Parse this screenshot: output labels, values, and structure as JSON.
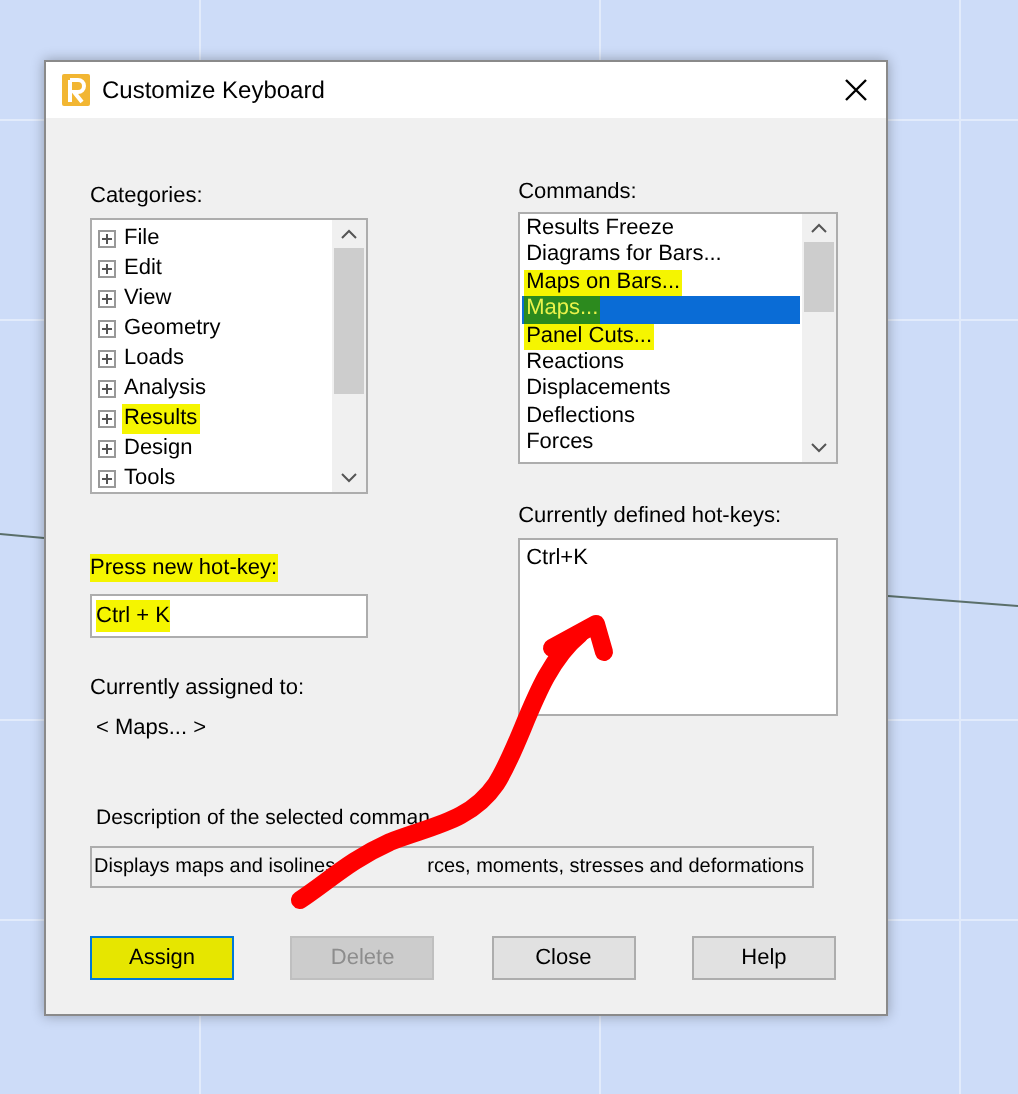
{
  "window": {
    "title": "Customize Keyboard"
  },
  "categories": {
    "label": "Categories:",
    "items": [
      {
        "text": "File",
        "highlighted": false
      },
      {
        "text": "Edit",
        "highlighted": false
      },
      {
        "text": "View",
        "highlighted": false
      },
      {
        "text": "Geometry",
        "highlighted": false
      },
      {
        "text": "Loads",
        "highlighted": false
      },
      {
        "text": "Analysis",
        "highlighted": false
      },
      {
        "text": "Results",
        "highlighted": true
      },
      {
        "text": "Design",
        "highlighted": false
      },
      {
        "text": "Tools",
        "highlighted": false
      }
    ]
  },
  "commands": {
    "label": "Commands:",
    "items": [
      {
        "text": "Results Freeze",
        "selected": false,
        "highlighted": false
      },
      {
        "text": "Diagrams for Bars...",
        "selected": false,
        "highlighted": false
      },
      {
        "text": "Maps on Bars...",
        "selected": false,
        "highlighted": true
      },
      {
        "text": "Maps...",
        "selected": true,
        "highlighted": true
      },
      {
        "text": "Panel Cuts...",
        "selected": false,
        "highlighted": true
      },
      {
        "text": "Reactions",
        "selected": false,
        "highlighted": false
      },
      {
        "text": "Displacements",
        "selected": false,
        "highlighted": false
      },
      {
        "text": "Deflections",
        "selected": false,
        "highlighted": false
      },
      {
        "text": "Forces",
        "selected": false,
        "highlighted": false
      }
    ]
  },
  "new_hotkey": {
    "label": "Press new hot-key:",
    "value": "Ctrl + K",
    "highlighted": true
  },
  "assigned": {
    "label": "Currently assigned to:",
    "value": "< Maps... >"
  },
  "defined_hotkeys": {
    "label": "Currently defined hot-keys:",
    "items": [
      "Ctrl+K"
    ]
  },
  "description": {
    "label": "Description of the selected comman",
    "value_parts": [
      "Displays maps and isolines",
      "rces, moments, stresses and deformations"
    ]
  },
  "buttons": [
    {
      "label": "Assign",
      "disabled": false,
      "focused": true,
      "highlighted": true
    },
    {
      "label": "Delete",
      "disabled": true,
      "focused": false,
      "highlighted": false
    },
    {
      "label": "Close",
      "disabled": false,
      "focused": false,
      "highlighted": false
    },
    {
      "label": "Help",
      "disabled": false,
      "focused": false,
      "highlighted": false
    }
  ]
}
